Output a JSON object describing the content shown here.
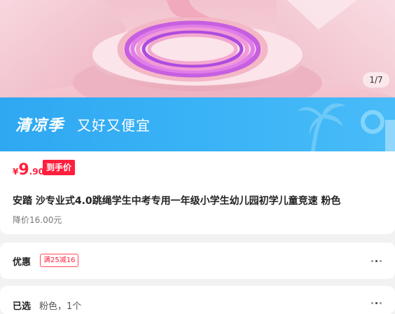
{
  "hero": {
    "page_indicator": "1/7",
    "image_name": "pink jump rope product image"
  },
  "promo": {
    "title": "清凉季",
    "subtitle": "又好又便宜"
  },
  "price": {
    "currency": "¥",
    "integer": "9",
    "decimal": ".90",
    "tag": "到手价"
  },
  "product": {
    "title": "安踏 沙专业式4.0跳绳学生中考专用一年级小学生幼儿园初学儿童竞速 粉色",
    "price_drop": "降价16.00元"
  },
  "discount": {
    "label": "优惠",
    "coupon": "满25减16"
  },
  "selected": {
    "label": "已选",
    "value": "粉色，1个"
  },
  "colors": {
    "accent_red": "#ff1f3d",
    "promo_blue": "#3bb3f6",
    "hero_pink": "#f6cfd8"
  }
}
